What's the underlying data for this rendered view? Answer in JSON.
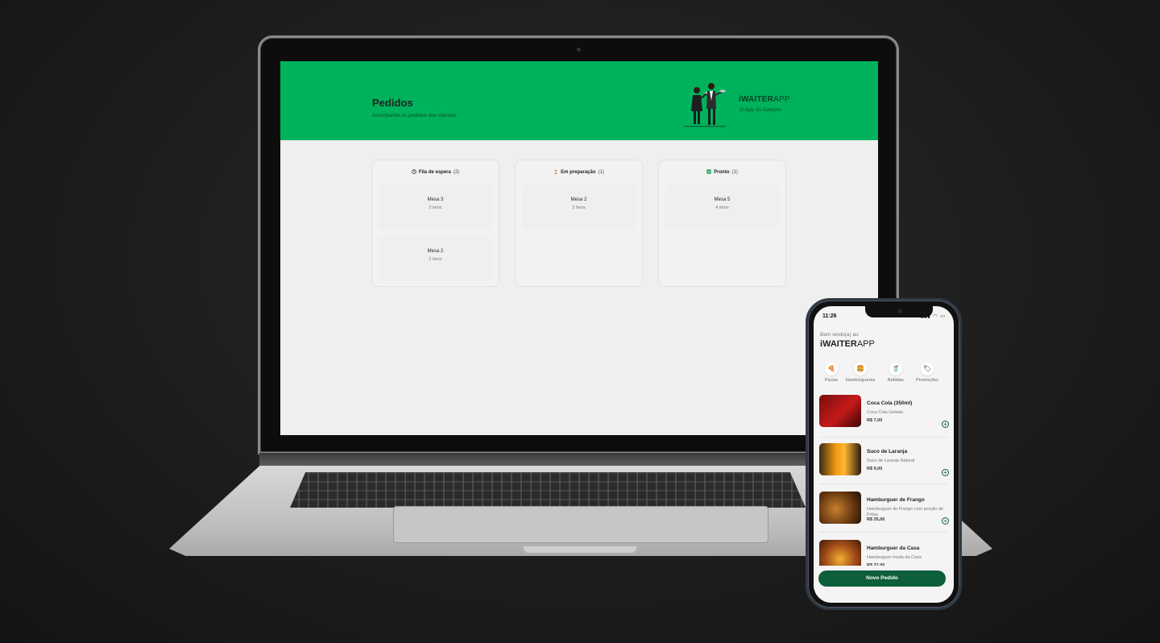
{
  "desktop": {
    "header": {
      "title": "Pedidos",
      "subtitle": "Acompanhe os pedidos dos clientes",
      "brand_bold": "WAITER",
      "brand_prefix": "i",
      "brand_suffix": "APP",
      "brand_tagline": "O App do Garçom",
      "accent_color": "#00b25c"
    },
    "columns": [
      {
        "icon": "clock-icon",
        "label": "Fila de espera",
        "count": "(2)",
        "orders": [
          {
            "table": "Mesa 3",
            "items": "2 itens"
          },
          {
            "table": "Mesa 2",
            "items": "2 itens"
          }
        ]
      },
      {
        "icon": "cook-icon",
        "label": "Em preparação",
        "count": "(1)",
        "orders": [
          {
            "table": "Mesa 2",
            "items": "2 itens"
          }
        ]
      },
      {
        "icon": "check-icon",
        "label": "Pronto",
        "count": "(1)",
        "orders": [
          {
            "table": "Mesa 5",
            "items": "4 itens"
          }
        ]
      }
    ]
  },
  "mobile": {
    "status": {
      "time": "11:26",
      "icons": "signal wifi battery"
    },
    "welcome": "Bem vindo(a) ao",
    "brand_bold": "WAITER",
    "brand_prefix": "i",
    "brand_suffix": "APP",
    "categories": [
      {
        "icon": "pizza-icon",
        "glyph": "🍕",
        "label": "Pizzas"
      },
      {
        "icon": "burger-icon",
        "glyph": "🍔",
        "label": "Hambúrgueres"
      },
      {
        "icon": "drink-icon",
        "glyph": "🥤",
        "label": "Bebidas"
      },
      {
        "icon": "promo-icon",
        "glyph": "🏷",
        "label": "Promoções"
      }
    ],
    "products": [
      {
        "name": "Coca Cola (350ml)",
        "description": "Coca Cola Gelada",
        "price": "R$ 7,00",
        "image": "coca-cola-image"
      },
      {
        "name": "Suco de Laranja",
        "description": "Suco de Laranja Natural",
        "price": "R$ 9,00",
        "image": "orange-juice-image"
      },
      {
        "name": "Hamburguer de Frango",
        "description": "Hamburguer de Frango com porção de Fritas",
        "price": "R$ 35,00",
        "image": "chicken-burger-image"
      },
      {
        "name": "Hamburguer da Casa",
        "description": "Hamburguer moda da Casa",
        "price": "R$ 37,00",
        "image": "house-burger-image"
      }
    ],
    "cta_label": "Novo Pedido",
    "cta_color": "#0c5f3a"
  }
}
